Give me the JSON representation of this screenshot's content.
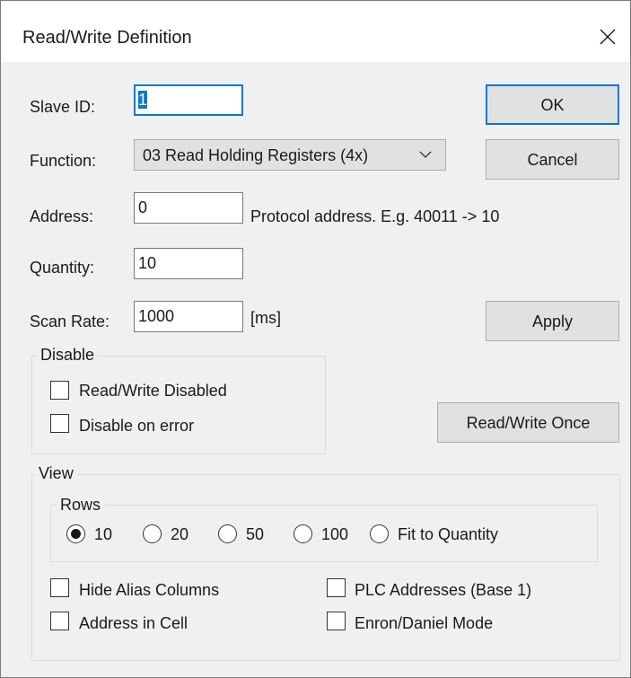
{
  "window": {
    "title": "Read/Write Definition",
    "close_icon": "close-icon"
  },
  "form": {
    "slave_id": {
      "label": "Slave ID:",
      "value": "1"
    },
    "function": {
      "label": "Function:",
      "value": "03 Read Holding Registers (4x)"
    },
    "address": {
      "label": "Address:",
      "value": "0",
      "hint": "Protocol address. E.g. 40011 -> 10"
    },
    "quantity": {
      "label": "Quantity:",
      "value": "10"
    },
    "scan_rate": {
      "label": "Scan Rate:",
      "value": "1000",
      "unit": "[ms]"
    }
  },
  "buttons": {
    "ok": "OK",
    "cancel": "Cancel",
    "apply": "Apply",
    "read_write_once": "Read/Write Once"
  },
  "disable_group": {
    "title": "Disable",
    "read_write_disabled": {
      "label": "Read/Write Disabled",
      "checked": false
    },
    "disable_on_error": {
      "label": "Disable on error",
      "checked": false
    }
  },
  "view_group": {
    "title": "View",
    "rows": {
      "title": "Rows",
      "options": [
        "10",
        "20",
        "50",
        "100",
        "Fit to Quantity"
      ],
      "selected": "10"
    },
    "hide_alias_columns": {
      "label": "Hide Alias Columns",
      "checked": false
    },
    "address_in_cell": {
      "label": "Address in Cell",
      "checked": false
    },
    "plc_addresses": {
      "label": "PLC Addresses (Base 1)",
      "checked": false
    },
    "enron_daniel_mode": {
      "label": "Enron/Daniel Mode",
      "checked": false
    }
  },
  "colors": {
    "accent": "#0078d7",
    "button_face": "#e1e1e1",
    "dialog_bg": "#f0f0f0"
  }
}
